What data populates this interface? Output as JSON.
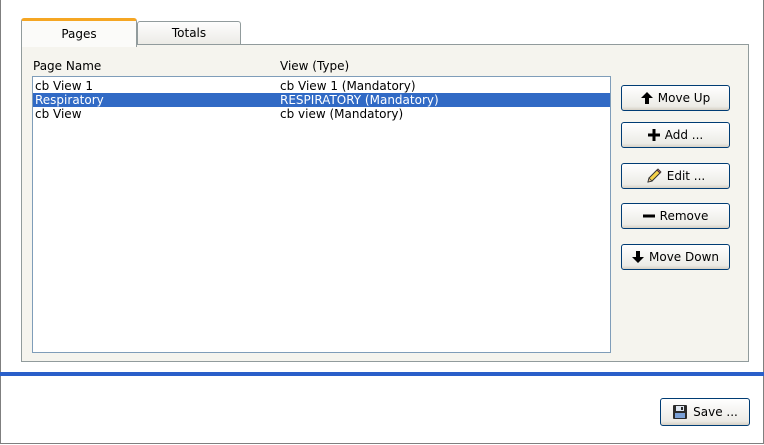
{
  "tabs": [
    {
      "label": "Pages",
      "active": true
    },
    {
      "label": "Totals",
      "active": false
    }
  ],
  "list": {
    "headers": {
      "name": "Page Name",
      "view": "View (Type)"
    },
    "rows": [
      {
        "name": "cb View 1",
        "view": "cb View 1 (Mandatory)",
        "selected": false
      },
      {
        "name": "Respiratory",
        "view": "RESPIRATORY (Mandatory)",
        "selected": true
      },
      {
        "name": "cb View",
        "view": "cb view (Mandatory)",
        "selected": false
      }
    ]
  },
  "buttons": {
    "move_up": "Move Up",
    "add": "Add ...",
    "edit": "Edit ...",
    "remove": "Remove",
    "move_down": "Move Down",
    "save": "Save ..."
  },
  "icons": {
    "move_up": "arrow-up-icon",
    "add": "plus-icon",
    "edit": "pencil-icon",
    "remove": "minus-icon",
    "move_down": "arrow-down-icon",
    "save": "floppy-disk-icon"
  },
  "colors": {
    "selection": "#316ac5",
    "active_tab_accent": "#f5a623",
    "separator": "#2a5fc9"
  }
}
